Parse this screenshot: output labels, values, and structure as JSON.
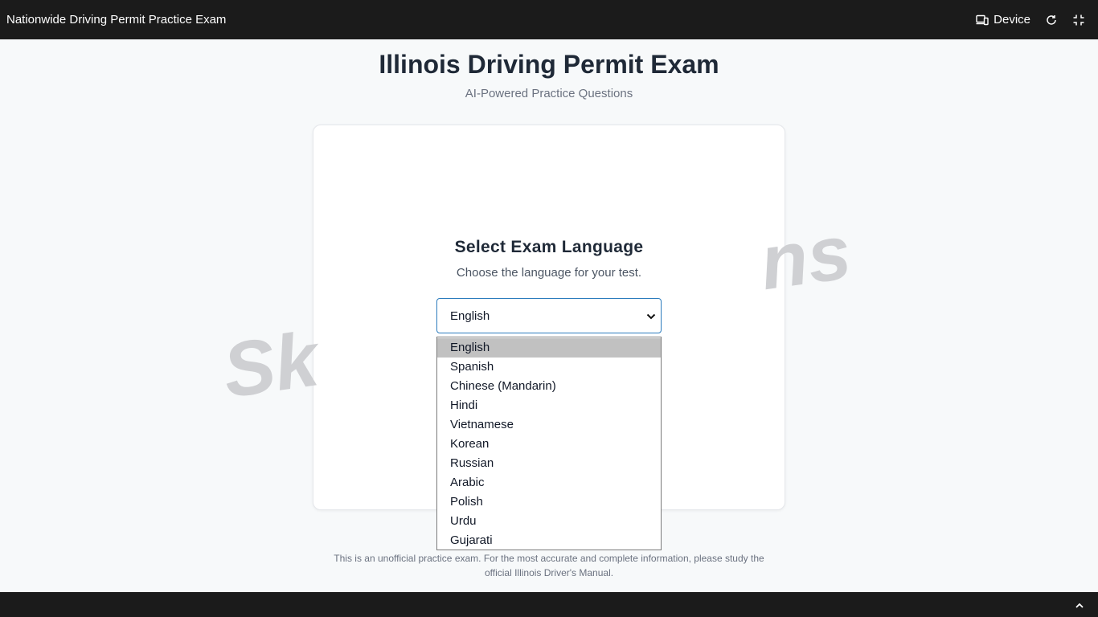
{
  "topbar": {
    "app_title": "Nationwide Driving Permit Practice Exam",
    "device_label": "Device"
  },
  "header": {
    "title": "Illinois Driving Permit Exam",
    "subtitle": "AI-Powered Practice Questions"
  },
  "card": {
    "heading": "Select Exam Language",
    "subheading": "Choose the language for your test.",
    "watermark": {
      "left": "Sk",
      "right": "ns"
    }
  },
  "language_select": {
    "selected": "English",
    "options": [
      "English",
      "Spanish",
      "Chinese (Mandarin)",
      "Hindi",
      "Vietnamese",
      "Korean",
      "Russian",
      "Arabic",
      "Polish",
      "Urdu",
      "Gujarati"
    ]
  },
  "footer": {
    "disclaimer": "This is an unofficial practice exam. For the most accurate and complete information, please study the official Illinois Driver's Manual."
  },
  "colors": {
    "topbar": "#1b1b1b",
    "accent": "#2b7bbd",
    "highlight": "#c1c1c1"
  },
  "icons": {
    "device": "device-icon",
    "refresh": "refresh-icon",
    "collapse": "collapse-icon",
    "chevron_up": "chevron-up-icon",
    "select_chevron": "chevron-down-icon"
  }
}
